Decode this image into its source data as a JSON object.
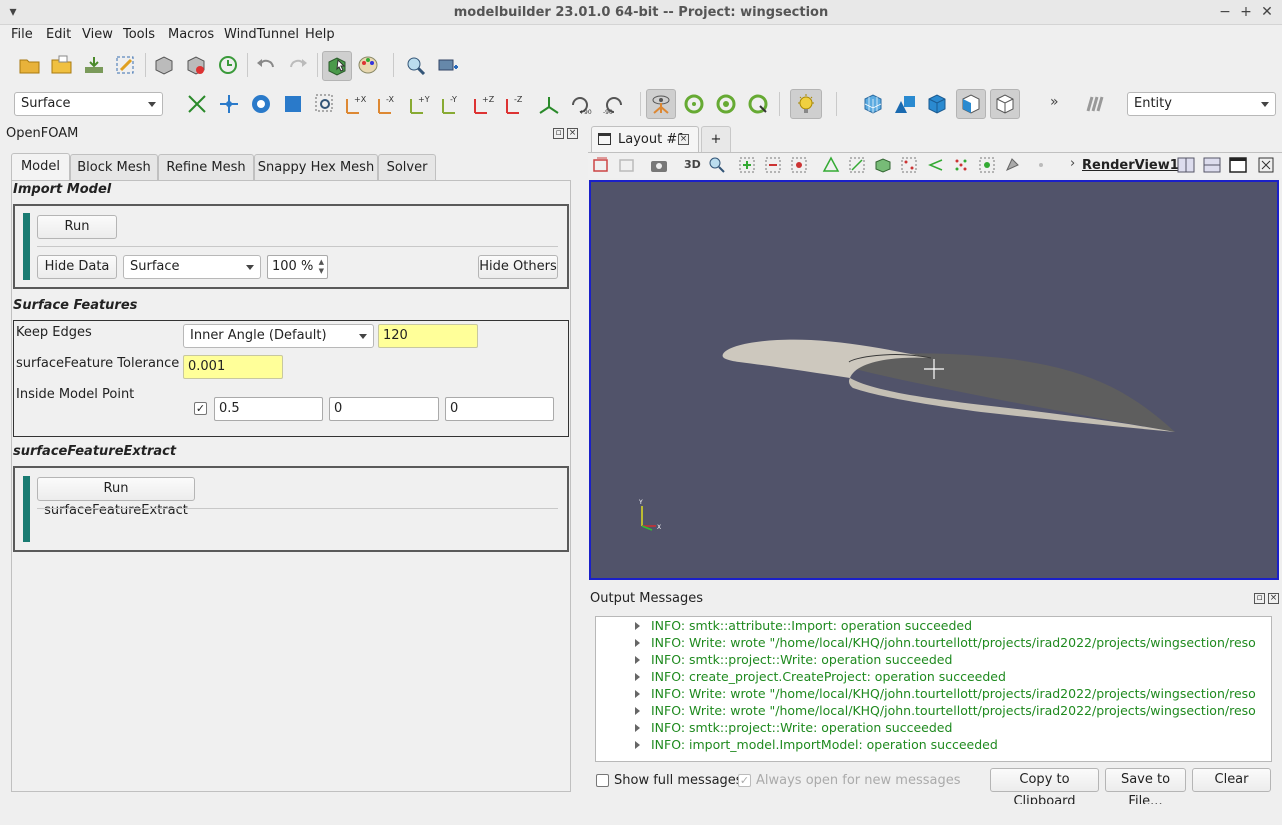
{
  "window": {
    "title": "modelbuilder 23.01.0 64-bit -- Project: wingsection"
  },
  "menu": [
    "File",
    "Edit",
    "View",
    "Tools",
    "Macros",
    "WindTunnel",
    "Help"
  ],
  "toolbar2": {
    "representation": "Surface",
    "selection_type": "Entity"
  },
  "left_panel": {
    "title": "OpenFOAM",
    "tabs": [
      "Model",
      "Block Mesh",
      "Refine Mesh",
      "Snappy Hex Mesh",
      "Solver"
    ],
    "import_model": {
      "title": "Import Model",
      "run_label": "Run",
      "hide_data_label": "Hide Data",
      "representation": "Surface",
      "opacity": "100 %",
      "hide_others_label": "Hide Others"
    },
    "surface_features": {
      "title": "Surface Features",
      "keep_edges_label": "Keep Edges",
      "keep_edges_mode": "Inner Angle (Default)",
      "keep_edges_value": "120",
      "tolerance_label": "surfaceFeature Tolerance",
      "tolerance_value": "0.001",
      "inside_point_label": "Inside Model Point",
      "inside_point": [
        "0.5",
        "0",
        "0"
      ]
    },
    "surface_feature_extract": {
      "title": "surfaceFeatureExtract",
      "run_label": "Run surfaceFeatureExtract"
    }
  },
  "view": {
    "layout_tab": "Layout #1",
    "add_tab": "+",
    "btn_3d": "3D",
    "render_view": "RenderView1",
    "background": "#51536a"
  },
  "output": {
    "title": "Output Messages",
    "messages": [
      "INFO: smtk::attribute::Import: operation succeeded",
      "INFO: Write: wrote \"/home/local/KHQ/john.tourtellott/projects/irad2022/projects/wingsection/resources/...",
      "INFO: smtk::project::Write: operation succeeded",
      "INFO: create_project.CreateProject: operation succeeded",
      "INFO: Write: wrote \"/home/local/KHQ/john.tourtellott/projects/irad2022/projects/wingsection/resources/...",
      "INFO: Write: wrote \"/home/local/KHQ/john.tourtellott/projects/irad2022/projects/wingsection/resources/...",
      "INFO: smtk::project::Write: operation succeeded",
      "INFO: import_model.ImportModel: operation succeeded"
    ],
    "show_full_label": "Show full messages",
    "always_open_label": "Always open for new messages",
    "copy_label": "Copy to Clipboard",
    "save_label": "Save to File...",
    "clear_label": "Clear"
  }
}
